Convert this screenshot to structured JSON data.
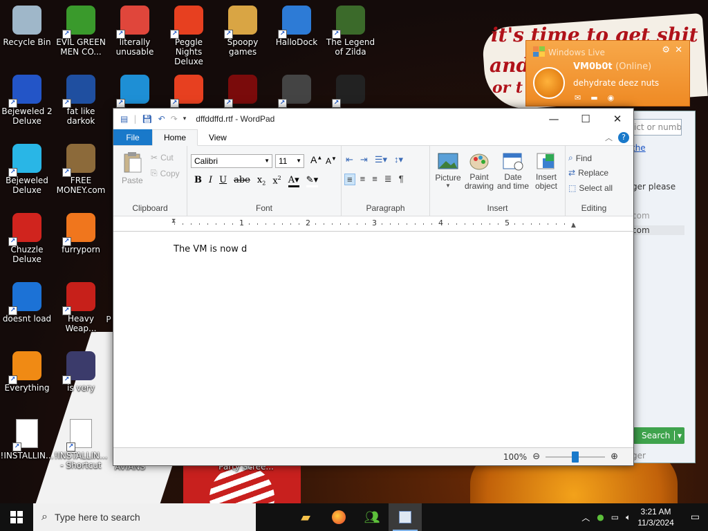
{
  "desktop": {
    "wallpaper_text": [
      "it's time to get shit",
      "and",
      "or t"
    ],
    "icons": [
      {
        "label": "Recycle Bin",
        "icon": "recycle-bin-icon",
        "color": "#9fb7c9"
      },
      {
        "label": "EVIL GREEN MEN CO...",
        "icon": "messenger-people-icon",
        "color": "#3a9a2c"
      },
      {
        "label": "literally unusable",
        "icon": "chrome-icon",
        "color": "#e0463b"
      },
      {
        "label": "Peggle Nights Deluxe",
        "icon": "peggle-icon",
        "color": "#e74020"
      },
      {
        "label": "Spoopy games",
        "icon": "folder-icon",
        "color": "#d9a544"
      },
      {
        "label": "HalloDock",
        "icon": "windows-shield-icon",
        "color": "#2d7bd6"
      },
      {
        "label": "The Legend of Zilda",
        "icon": "zelda-icon",
        "color": "#3b6a2a"
      },
      {
        "label": "Bejeweled 2 Deluxe",
        "icon": "bejeweled-icon",
        "color": "#2355c7"
      },
      {
        "label": "fat like darkok",
        "icon": "mpl-icon",
        "color": "#1f4fa0"
      },
      {
        "label": "",
        "icon": "edge-icon",
        "color": "#1e8fd5"
      },
      {
        "label": "",
        "icon": "peggle-icon",
        "color": "#e74020"
      },
      {
        "label": "",
        "icon": "flash-icon",
        "color": "#7a0b0b"
      },
      {
        "label": "",
        "icon": "remote-desktop-icon",
        "color": "#444444"
      },
      {
        "label": "",
        "icon": "yashma-shield-icon",
        "color": "#222222"
      },
      {
        "label": "Bejeweled Deluxe",
        "icon": "gem-icon",
        "color": "#29b6e6"
      },
      {
        "label": "FREE MONEY.com",
        "icon": "money-bag-icon",
        "color": "#8c6a3a"
      },
      {
        "label": "Chuzzle Deluxe",
        "icon": "chuzzle-icon",
        "color": "#d0241e"
      },
      {
        "label": "furryporn",
        "icon": "firefox-icon",
        "color": "#f0761d"
      },
      {
        "label": "doesnt load",
        "icon": "thunderbird-icon",
        "color": "#1c72d6"
      },
      {
        "label": "Heavy Weap...",
        "icon": "radiation-icon",
        "color": "#c7201a"
      },
      {
        "label": "Everything",
        "icon": "everything-search-icon",
        "color": "#f08a14"
      },
      {
        "label": "is very",
        "icon": "mpl-shield-icon",
        "color": "#3b3b6b"
      },
      {
        "label": "!INSTALLIN...",
        "icon": "text-file-icon",
        "color": "#ffffff"
      },
      {
        "label": "!INSTALLIN... - Shortcut",
        "icon": "text-file-icon",
        "color": "#ffffff"
      }
    ],
    "partial_labels": [
      "AVIANS",
      "Party Scree...",
      "P"
    ]
  },
  "messenger_popup": {
    "title": "Windows Live",
    "name": "VM0b0t",
    "status": "(Online)",
    "message": "dehydrate deez nuts"
  },
  "messenger_window": {
    "search_placeholder": "ict or numbe",
    "lines": [
      "the",
      "ger please",
      "com",
      "com",
      "ger"
    ],
    "search_button": "Search"
  },
  "wordpad": {
    "title": "dffddffd.rtf - WordPad",
    "tabs": [
      "File",
      "Home",
      "View"
    ],
    "clipboard": {
      "paste": "Paste",
      "cut": "Cut",
      "copy": "Copy",
      "label": "Clipboard"
    },
    "font": {
      "family": "Calibri",
      "size": "11",
      "label": "Font"
    },
    "paragraph": {
      "label": "Paragraph"
    },
    "insert": {
      "picture": "Picture",
      "paint": "Paint drawing",
      "datetime": "Date and time",
      "object": "Insert object",
      "label": "Insert"
    },
    "editing": {
      "find": "Find",
      "replace": "Replace",
      "select_all": "Select all",
      "label": "Editing"
    },
    "ruler_numbers": [
      "1",
      "2",
      "3",
      "4",
      "5"
    ],
    "document_text": "The VM is now d",
    "zoom": "100%"
  },
  "taskbar": {
    "search_placeholder": "Type here to search",
    "time": "3:21 AM",
    "date": "11/3/2024"
  }
}
